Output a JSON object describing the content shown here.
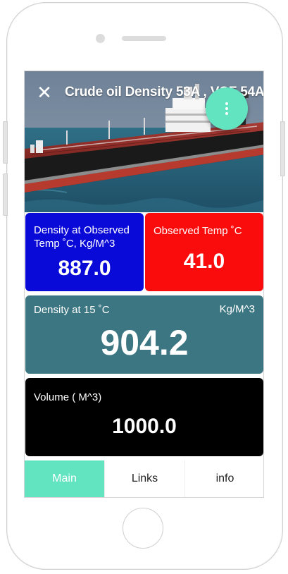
{
  "app": {
    "title": "Crude oil Density 53A , VCF 54A"
  },
  "icons": {
    "close": "close-icon",
    "menu": "more-vertical-icon"
  },
  "cards": {
    "observed_density": {
      "label": "Density at Observed Temp ˚C, Kg/M^3",
      "value": "887.0",
      "color": "#0a0ad8"
    },
    "observed_temp": {
      "label": "Observed Temp ˚C",
      "value": "41.0",
      "color": "#fb0c0c"
    },
    "density_15": {
      "label": "Density at 15 ˚C",
      "unit": "Kg/M^3",
      "value": "904.2",
      "color": "#3c7682"
    },
    "volume": {
      "label": "Volume ( M^3)",
      "value": "1000.0",
      "color": "#000000"
    }
  },
  "tabs": [
    {
      "label": "Main",
      "active": true
    },
    {
      "label": "Links",
      "active": false
    },
    {
      "label": "info",
      "active": false
    }
  ],
  "colors": {
    "accent": "#62e4c1"
  }
}
